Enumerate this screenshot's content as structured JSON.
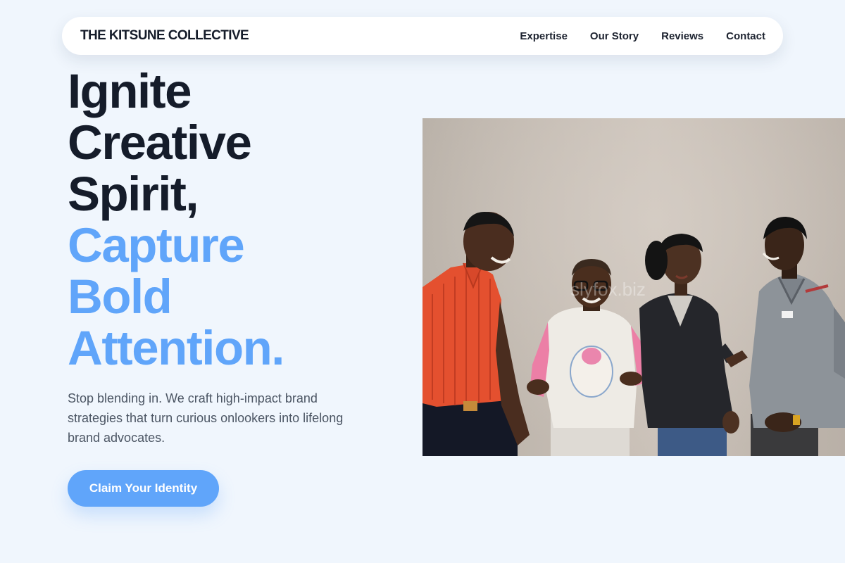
{
  "nav": {
    "brand": "THE KITSUNE COLLECTIVE",
    "links": [
      {
        "label": "Expertise"
      },
      {
        "label": "Our Story"
      },
      {
        "label": "Reviews"
      },
      {
        "label": "Contact"
      }
    ]
  },
  "hero": {
    "headline_dark": [
      "Ignite",
      "Creative",
      "Spirit,"
    ],
    "headline_accent": [
      "Capture",
      "Bold",
      "Attention."
    ],
    "description": "Stop blending in. We craft high-impact brand strategies that turn curious onlookers into lifelong brand advocates.",
    "cta_label": "Claim Your Identity",
    "photo_watermark": "slyfox.biz"
  },
  "colors": {
    "background": "#f0f6fd",
    "text_dark": "#151c2a",
    "accent": "#60a5fa",
    "body_text": "#4b5563"
  }
}
